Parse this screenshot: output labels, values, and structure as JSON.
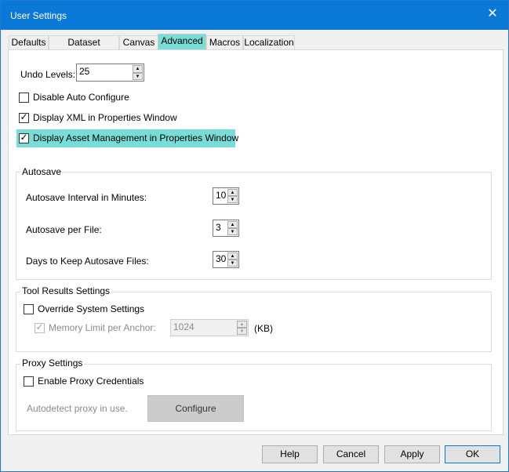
{
  "window": {
    "title": "User Settings",
    "close_glyph": "✕"
  },
  "tabs": [
    {
      "label": "Defaults"
    },
    {
      "label": "Dataset Defaults"
    },
    {
      "label": "Canvas"
    },
    {
      "label": "Advanced",
      "active": true
    },
    {
      "label": "Macros"
    },
    {
      "label": "Localization"
    }
  ],
  "general": {
    "undo_label": "Undo Levels:",
    "undo_value": "25",
    "disable_auto_configure": {
      "label": "Disable Auto Configure",
      "checked": false
    },
    "display_xml": {
      "label": "Display XML in Properties Window",
      "checked": true
    },
    "display_asset_mgmt": {
      "label": "Display Asset Management in Properties Window",
      "checked": true
    }
  },
  "autosave": {
    "title": "Autosave",
    "interval_label": "Autosave Interval in Minutes:",
    "interval_value": "10",
    "per_file_label": "Autosave per File:",
    "per_file_value": "3",
    "days_label": "Days to Keep Autosave Files:",
    "days_value": "30"
  },
  "tool_results": {
    "title": "Tool Results Settings",
    "override": {
      "label": "Override System Settings",
      "checked": false
    },
    "memory_limit": {
      "label": "Memory Limit per Anchor:",
      "checked": true,
      "value": "1024",
      "unit": "(KB)"
    }
  },
  "proxy": {
    "title": "Proxy Settings",
    "enable_credentials": {
      "label": "Enable Proxy Credentials",
      "checked": false
    },
    "autodetect_text": "Autodetect proxy in use.",
    "configure_label": "Configure"
  },
  "footer": {
    "help": "Help",
    "cancel": "Cancel",
    "apply": "Apply",
    "ok": "OK"
  },
  "colors": {
    "titlebar": "#0a78d7",
    "highlight": "#78ddd6"
  }
}
